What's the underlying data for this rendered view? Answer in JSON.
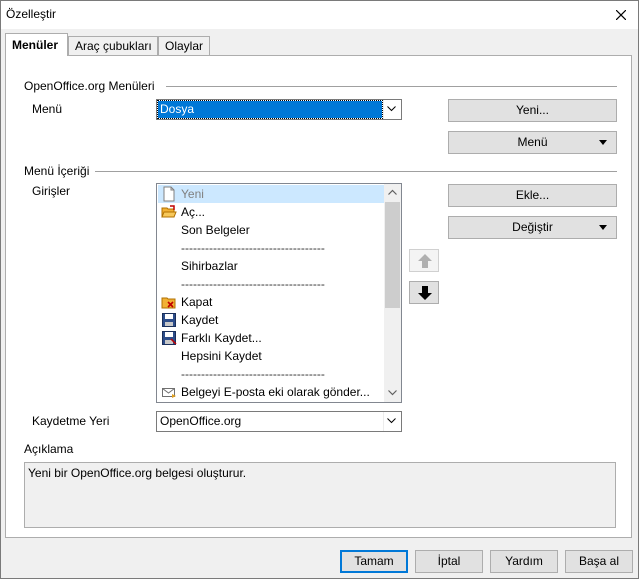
{
  "window": {
    "title": "Özelleştir"
  },
  "tabs": [
    {
      "label": "Menüler",
      "active": true
    },
    {
      "label": "Araç çubukları",
      "active": false
    },
    {
      "label": "Olaylar",
      "active": false
    }
  ],
  "menus_section": {
    "title": "OpenOffice.org  Menüleri",
    "menu_label": "Menü",
    "menu_value": "Dosya",
    "new_button": "Yeni...",
    "menu_button": "Menü"
  },
  "content_section": {
    "title": "Menü İçeriği",
    "entries_label": "Girişler",
    "entries": [
      {
        "label": "Yeni",
        "icon": "new-document-icon",
        "selected": true
      },
      {
        "label": "Aç...",
        "icon": "open-folder-icon"
      },
      {
        "label": "Son Belgeler",
        "icon": ""
      },
      {
        "label": "------------------------------------",
        "icon": "",
        "separator": true
      },
      {
        "label": "Sihirbazlar",
        "icon": ""
      },
      {
        "label": "------------------------------------",
        "icon": "",
        "separator": true
      },
      {
        "label": "Kapat",
        "icon": "close-folder-icon"
      },
      {
        "label": "Kaydet",
        "icon": "save-icon"
      },
      {
        "label": "Farklı Kaydet...",
        "icon": "save-as-icon"
      },
      {
        "label": "Hepsini Kaydet",
        "icon": ""
      },
      {
        "label": "------------------------------------",
        "icon": "",
        "separator": true
      },
      {
        "label": "Belgeyi E-posta eki olarak gönder...",
        "icon": "email-icon"
      }
    ],
    "add_button": "Ekle...",
    "modify_button": "Değiştir"
  },
  "save_location": {
    "label": "Kaydetme Yeri",
    "value": "OpenOffice.org"
  },
  "description": {
    "label": "Açıklama",
    "text": "Yeni bir OpenOffice.org belgesi oluşturur."
  },
  "footer": {
    "ok": "Tamam",
    "cancel": "İptal",
    "help": "Yardım",
    "reset": "Başa al"
  },
  "colors": {
    "accent": "#0078d7",
    "selection": "#cce8ff"
  }
}
